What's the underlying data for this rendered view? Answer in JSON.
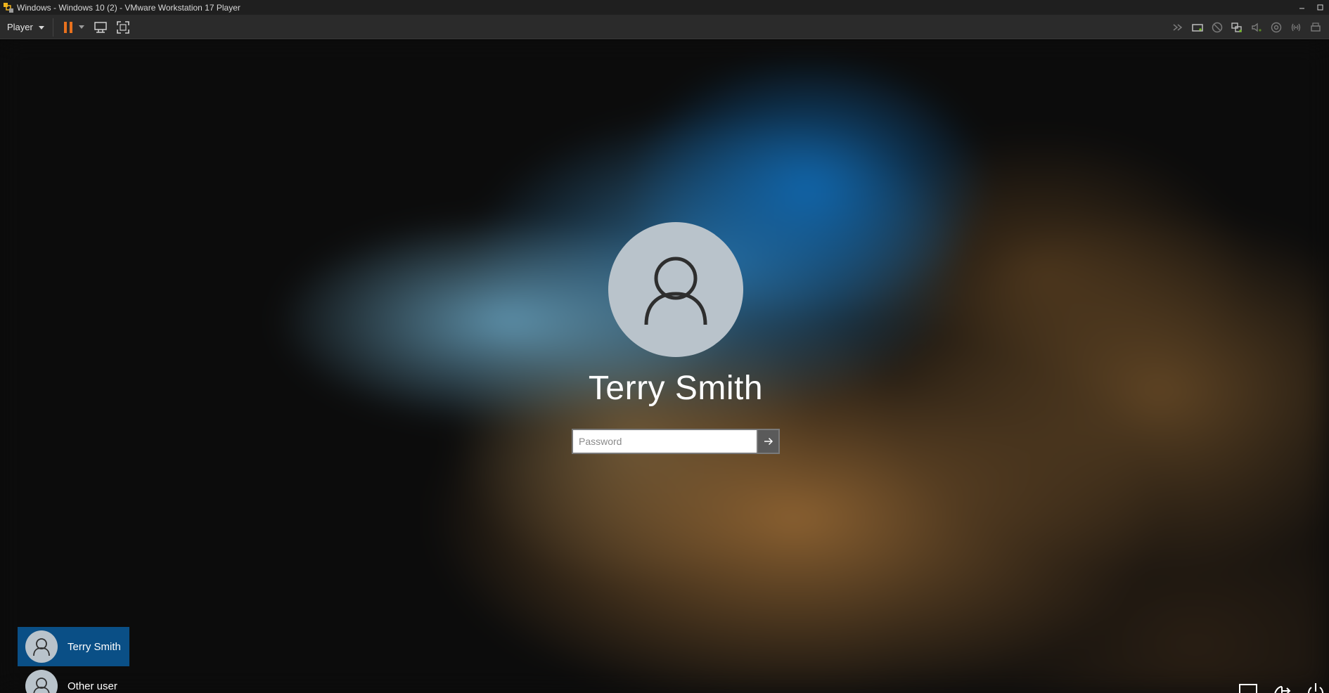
{
  "window": {
    "title": "Windows - Windows 10 (2) - VMware Workstation 17 Player"
  },
  "toolbar": {
    "player_label": "Player",
    "pause_icon": "pause-icon",
    "send_ctrl_alt_del_icon": "ctrl-alt-del-icon",
    "fullscreen_icon": "fullscreen-icon",
    "accent_color": "#e8711e"
  },
  "device_icons": [
    "forward-icon",
    "hard-disk-icon",
    "cd-dvd-icon",
    "network-adapter-icon",
    "sound-card-icon",
    "usb-icon",
    "wireless-icon",
    "printer-icon"
  ],
  "lock_screen": {
    "username": "Terry Smith",
    "password_placeholder": "Password",
    "password_value": "",
    "submit_icon": "arrow-right-icon"
  },
  "user_switcher": {
    "users": [
      {
        "name": "Terry Smith",
        "selected": true
      },
      {
        "name": "Other user",
        "selected": false
      }
    ],
    "selected_color": "#0a4f86"
  },
  "bottom_icons": [
    "network-icon",
    "accessibility-icon",
    "power-icon"
  ]
}
